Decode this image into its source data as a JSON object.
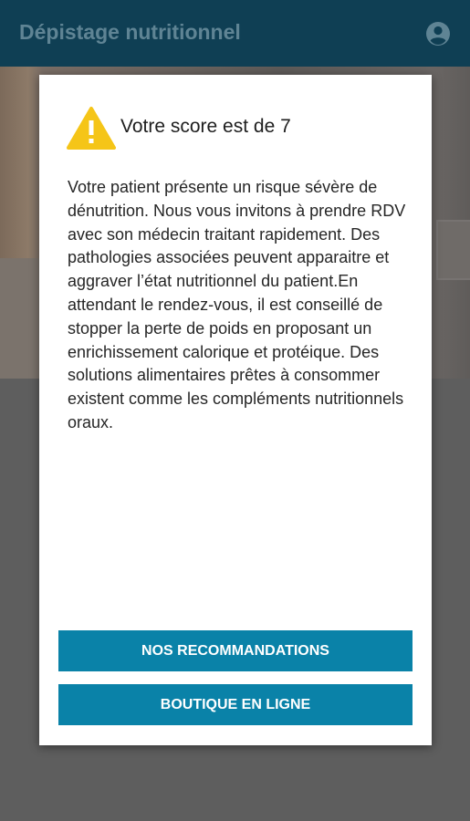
{
  "app_bar": {
    "title": "Dépistage nutritionnel",
    "account_icon": "account-circle-icon"
  },
  "dialog": {
    "icon": "warning-icon",
    "title": "Votre score est de 7",
    "message": "Votre patient présente un risque sévère de dénutrition. Nous vous invitons à prendre RDV avec son médecin traitant rapidement. Des pathologies associées peuvent apparaitre et aggraver l’état nutritionnel du patient.En attendant le rendez-vous, il est conseillé de stopper la perte de poids en proposant un enrichissement calorique et protéique. Des solutions alimentaires prêtes à consommer existent comme les compléments nutritionnels oraux.",
    "buttons": {
      "recommendations": "NOS RECOMMANDATIONS",
      "shop": "BOUTIQUE EN LIGNE"
    }
  },
  "colors": {
    "app_bar": "#0f3f54",
    "button": "#0a82a8",
    "warning": "#f5c518"
  }
}
